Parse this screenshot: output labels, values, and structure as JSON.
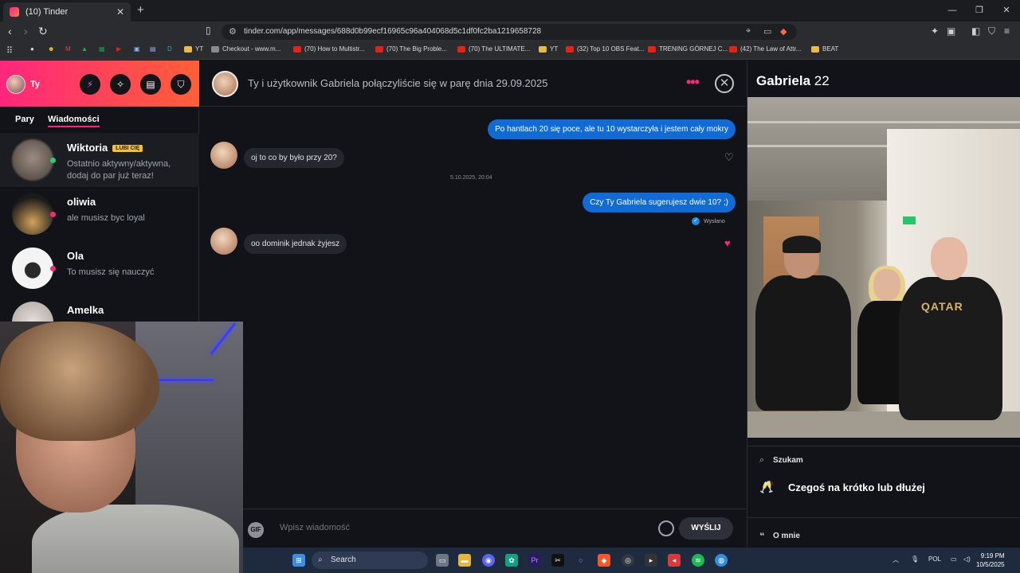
{
  "browser": {
    "tab_title": "(10) Tinder",
    "url": "tinder.com/app/messages/688d0b99ecf16965c96a404068d5c1df0fc2ba1219658728",
    "bookmarks": [
      {
        "label": "YT",
        "kind": "folder"
      },
      {
        "label": "Checkout - www.m...",
        "kind": "generic"
      },
      {
        "label": "(70) How to Multistr...",
        "kind": "yt"
      },
      {
        "label": "(70) The Big Proble...",
        "kind": "yt"
      },
      {
        "label": "(70) The ULTIMATE...",
        "kind": "yt"
      },
      {
        "label": "YT",
        "kind": "folder"
      },
      {
        "label": "(32) Top 10 OBS Feat...",
        "kind": "yt"
      },
      {
        "label": "TRENING GÓRNEJ C...",
        "kind": "yt"
      },
      {
        "label": "(42) The Law of Attr...",
        "kind": "yt"
      },
      {
        "label": "BEAT",
        "kind": "folder"
      }
    ]
  },
  "sidebar": {
    "me_name": "Ty",
    "tabs": [
      "Pary",
      "Wiadomości"
    ],
    "conversations": [
      {
        "name": "Wiktoria",
        "badge": "LUBI CIĘ",
        "message": "Ostatnio aktywny/aktywna, dodaj do par już teraz!",
        "dot_color": "#2ecc71"
      },
      {
        "name": "oliwia",
        "message": "ale musisz byc loyal",
        "dot_color": "#fd267d"
      },
      {
        "name": "Ola",
        "message": "To musisz się nauczyć",
        "dot_color": "#fd267d"
      },
      {
        "name": "Amelka",
        "message": ""
      }
    ]
  },
  "chat": {
    "header": "Ty i użytkownik Gabriela połączyliście się w parę dnia 29.09.2025",
    "messages": [
      {
        "dir": "out",
        "text": "Po hantlach 20 się poce, ale tu 10 wystarczyła i jestem cały mokry"
      },
      {
        "dir": "in",
        "text": "oj to co by było przy 20?",
        "liked": false
      },
      {
        "dir": "stamp",
        "text": "5.10.2025, 20:04"
      },
      {
        "dir": "out",
        "text": "Czy Ty Gabriela sugerujesz dwie 10? ;)"
      },
      {
        "dir": "status",
        "text": "Wysłano"
      },
      {
        "dir": "in",
        "text": "oo dominik jednak żyjesz",
        "liked": true
      }
    ],
    "input_placeholder": "Wpisz wiadomość",
    "gif_label": "GIF",
    "send_label": "WYŚLIJ"
  },
  "profile": {
    "name": "Gabriela",
    "age": "22",
    "photo_text": "QATAR",
    "looking_label": "Szukam",
    "looking_value": "Czegoś na krótko lub dłużej",
    "about_label": "O mnie"
  },
  "taskbar": {
    "search_label": "Search",
    "lang": "POL",
    "time": "9:19 PM",
    "date": "10/5/2025"
  },
  "colors": {
    "accent": "#fd267d",
    "outgoing_bubble": "#106bd6",
    "brand_gradient_end": "#ff6036"
  }
}
